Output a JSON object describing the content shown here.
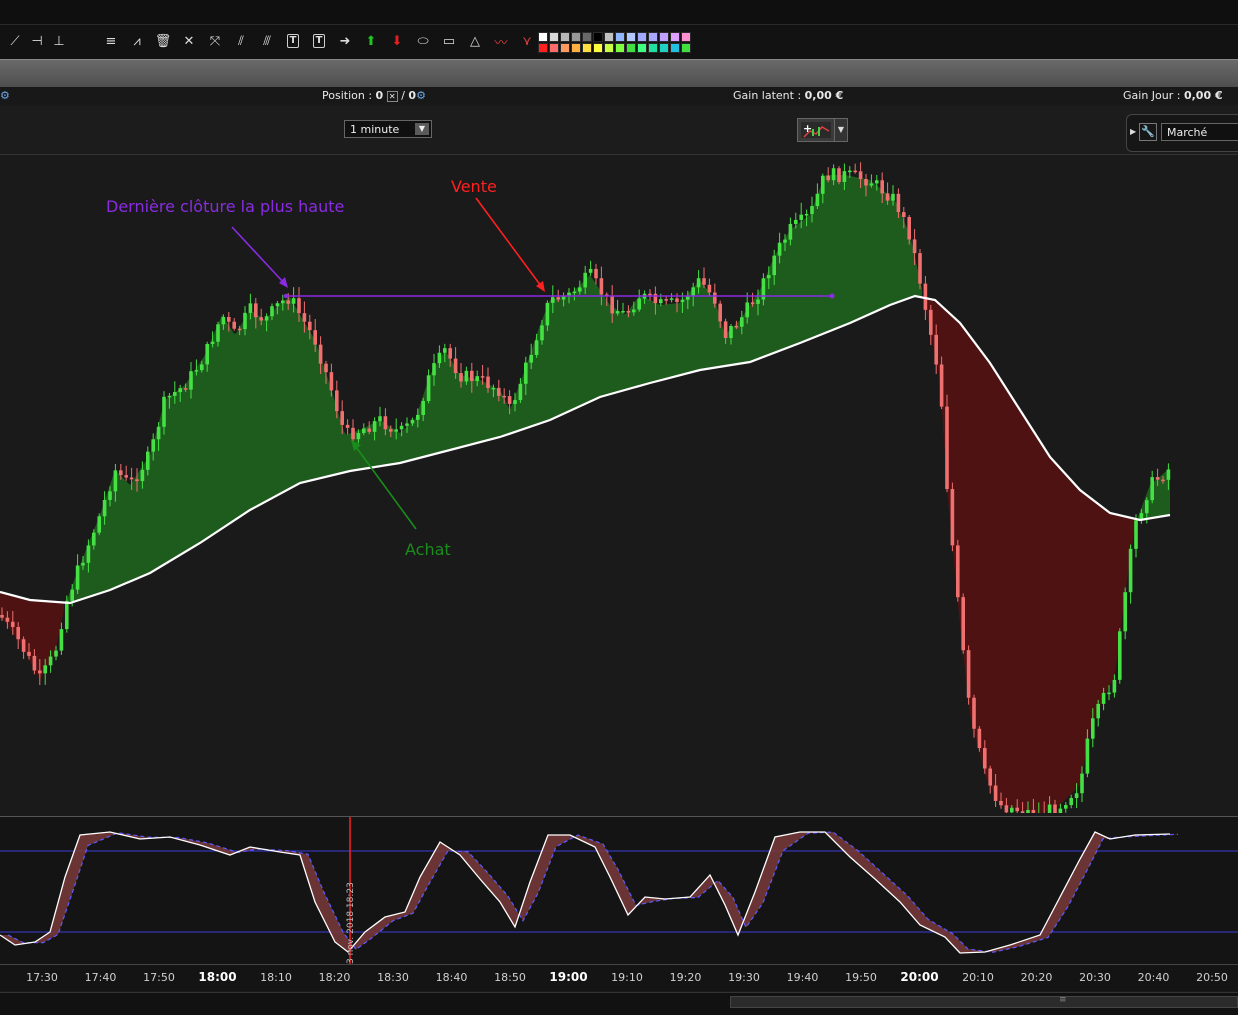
{
  "toolbar": {
    "tools": [
      {
        "name": "line-tool-icon",
        "glyph": "⟋"
      },
      {
        "name": "horizontal-line-icon",
        "glyph": "⊣"
      },
      {
        "name": "vertical-line-icon",
        "glyph": "⊥"
      },
      {
        "name": "fibonacci-icon",
        "glyph": "≡"
      },
      {
        "name": "zigzag-icon",
        "glyph": "⩘"
      },
      {
        "name": "trash-icon",
        "glyph": "🗑"
      },
      {
        "name": "tools-icon",
        "glyph": "✕"
      },
      {
        "name": "arrow-cross-icon",
        "glyph": "⤧"
      },
      {
        "name": "channel-icon",
        "glyph": "⫽"
      },
      {
        "name": "parallel-lines-icon",
        "glyph": "⫻"
      },
      {
        "name": "text-icon",
        "glyph": "T",
        "boxed": true
      },
      {
        "name": "text-anchor-icon",
        "glyph": "T",
        "boxed": true
      },
      {
        "name": "arrow-right-icon",
        "glyph": "➜"
      },
      {
        "name": "arrow-up-green-icon",
        "glyph": "⬆",
        "color": "#1ec81e"
      },
      {
        "name": "arrow-down-red-icon",
        "glyph": "⬇",
        "color": "#e02020"
      },
      {
        "name": "ellipse-icon",
        "glyph": "⬭"
      },
      {
        "name": "rectangle-icon",
        "glyph": "▭"
      },
      {
        "name": "triangle-icon",
        "glyph": "△"
      },
      {
        "name": "pattern-icon",
        "glyph": "〰",
        "color": "#e04040"
      },
      {
        "name": "pattern2-icon",
        "glyph": "⋎",
        "color": "#e04040"
      }
    ],
    "palette_top": [
      "#ffffff",
      "#d8d8d8",
      "#b8b8b8",
      "#989898",
      "#686868",
      "#000000",
      "#c0c0c0",
      "#8fb6ff",
      "#b0c8ff",
      "#a0a8ff",
      "#a8a8ff",
      "#c0a0ff",
      "#e0a0ff",
      "#ff8fd0"
    ],
    "palette_bottom": [
      "#ff2020",
      "#ff6a6a",
      "#ff9a60",
      "#ffb040",
      "#ffe040",
      "#ffff40",
      "#c8ff40",
      "#80ff40",
      "#40e040",
      "#40ff80",
      "#20e0a0",
      "#20d0c0",
      "#20c0e0",
      "#40e040"
    ]
  },
  "infobar": {
    "position_label": "Position :",
    "position_value": "0",
    "position_sep": "/",
    "position_value2": "0",
    "latent_label": "Gain latent :",
    "latent_value": "0,00 €",
    "day_label": "Gain Jour :",
    "day_value": "0,00 €"
  },
  "controls": {
    "timeframe": "1 minute",
    "order_type": "Marché"
  },
  "annotations": {
    "highest_close": "Dernière clôture la plus haute",
    "sell": "Vente",
    "buy": "Achat"
  },
  "oscillator": {
    "cursor_date": "3 nov. 2018 18:23"
  },
  "time_axis": [
    {
      "label": "17:30",
      "bold": false
    },
    {
      "label": "17:40",
      "bold": false
    },
    {
      "label": "17:50",
      "bold": false
    },
    {
      "label": "18:00",
      "bold": true
    },
    {
      "label": "18:10",
      "bold": false
    },
    {
      "label": "18:20",
      "bold": false
    },
    {
      "label": "18:30",
      "bold": false
    },
    {
      "label": "18:40",
      "bold": false
    },
    {
      "label": "18:50",
      "bold": false
    },
    {
      "label": "19:00",
      "bold": true
    },
    {
      "label": "19:10",
      "bold": false
    },
    {
      "label": "19:20",
      "bold": false
    },
    {
      "label": "19:30",
      "bold": false
    },
    {
      "label": "19:40",
      "bold": false
    },
    {
      "label": "19:50",
      "bold": false
    },
    {
      "label": "20:00",
      "bold": true
    },
    {
      "label": "20:10",
      "bold": false
    },
    {
      "label": "20:20",
      "bold": false
    },
    {
      "label": "20:30",
      "bold": false
    },
    {
      "label": "20:40",
      "bold": false
    },
    {
      "label": "20:50",
      "bold": false
    }
  ],
  "colors": {
    "bull": "#44e044",
    "bear": "#f07070",
    "bull_fill": "#1e5c1e",
    "bear_fill": "#4e1212",
    "ma": "#ffffff",
    "annot_purple": "#8a2be2",
    "annot_red": "#ff2020",
    "annot_green": "#1a8c1a",
    "cursor": "#ff2020"
  }
}
